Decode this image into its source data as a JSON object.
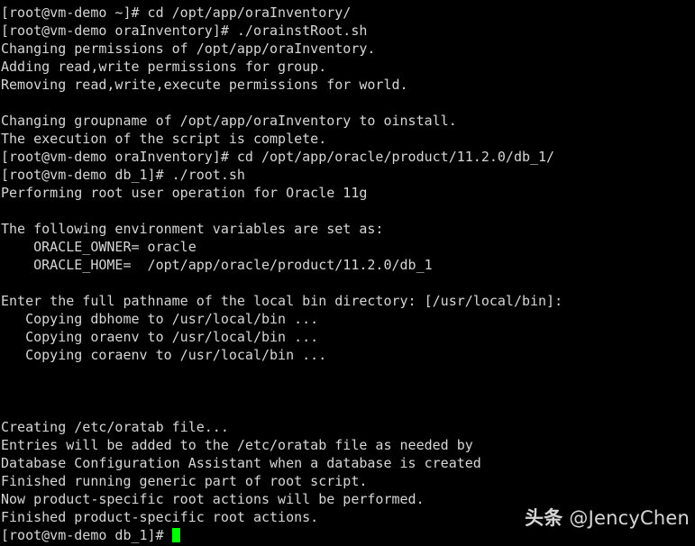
{
  "terminal": {
    "background_color": "#000000",
    "text_color": "#d6d6d6",
    "cursor_color": "#00ff00",
    "lines": [
      "[root@vm-demo ~]# cd /opt/app/oraInventory/",
      "[root@vm-demo oraInventory]# ./orainstRoot.sh",
      "Changing permissions of /opt/app/oraInventory.",
      "Adding read,write permissions for group.",
      "Removing read,write,execute permissions for world.",
      "",
      "Changing groupname of /opt/app/oraInventory to oinstall.",
      "The execution of the script is complete.",
      "[root@vm-demo oraInventory]# cd /opt/app/oracle/product/11.2.0/db_1/",
      "[root@vm-demo db_1]# ./root.sh",
      "Performing root user operation for Oracle 11g",
      "",
      "The following environment variables are set as:",
      "    ORACLE_OWNER= oracle",
      "    ORACLE_HOME=  /opt/app/oracle/product/11.2.0/db_1",
      "",
      "Enter the full pathname of the local bin directory: [/usr/local/bin]:",
      "   Copying dbhome to /usr/local/bin ...",
      "   Copying oraenv to /usr/local/bin ...",
      "   Copying coraenv to /usr/local/bin ...",
      "",
      "",
      "",
      "Creating /etc/oratab file...",
      "Entries will be added to the /etc/oratab file as needed by",
      "Database Configuration Assistant when a database is created",
      "Finished running generic part of root script.",
      "Now product-specific root actions will be performed.",
      "Finished product-specific root actions."
    ],
    "final_prompt": "[root@vm-demo db_1]# ",
    "cursor": "block"
  },
  "watermark": {
    "source_label": "头条",
    "handle": "@JencyChen",
    "color": "#e8e8e8"
  }
}
